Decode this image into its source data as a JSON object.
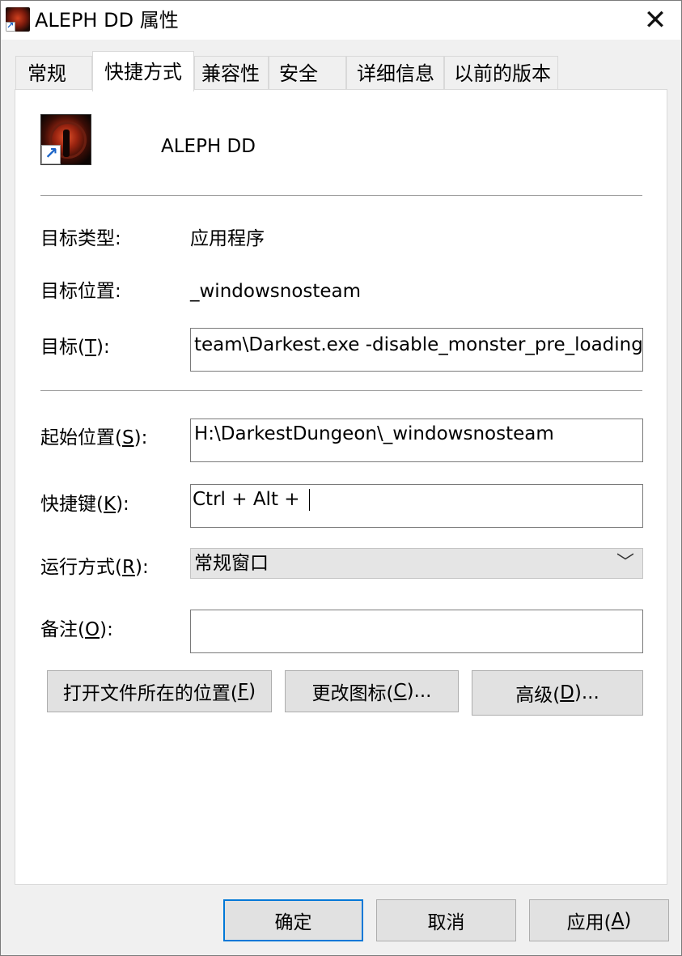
{
  "window": {
    "title": "ALEPH DD 属性"
  },
  "tabs": [
    {
      "label": "常规"
    },
    {
      "label": "快捷方式"
    },
    {
      "label": "兼容性"
    },
    {
      "label": "安全"
    },
    {
      "label": "详细信息"
    },
    {
      "label": "以前的版本"
    }
  ],
  "active_tab": "快捷方式",
  "shortcut": {
    "name": "ALEPH DD"
  },
  "info": {
    "target_type_label": "目标类型:",
    "target_type_value": "应用程序",
    "target_location_label": "目标位置:",
    "target_location_value": "_windowsnosteam",
    "target_label_pre": "目标(",
    "target_label_key": "T",
    "target_label_post": "):",
    "target_value": "team\\Darkest.exe -disable_monster_pre_loading"
  },
  "fields": {
    "start_in_label_pre": "起始位置(",
    "start_in_label_key": "S",
    "start_in_label_post": "):",
    "start_in_value": "H:\\DarkestDungeon\\_windowsnosteam",
    "hotkey_label_pre": "快捷键(",
    "hotkey_label_key": "K",
    "hotkey_label_post": "):",
    "hotkey_value": "Ctrl + Alt + ",
    "run_label_pre": "运行方式(",
    "run_label_key": "R",
    "run_label_post": "):",
    "run_value": "常规窗口",
    "comment_label_pre": "备注(",
    "comment_label_key": "O",
    "comment_label_post": "):",
    "comment_value": ""
  },
  "action_buttons": {
    "open_location_pre": "打开文件所在的位置(",
    "open_location_key": "F",
    "open_location_post": ")",
    "change_icon_pre": "更改图标(",
    "change_icon_key": "C",
    "change_icon_post": ")...",
    "advanced_pre": "高级(",
    "advanced_key": "D",
    "advanced_post": ")..."
  },
  "footer": {
    "ok": "确定",
    "cancel": "取消",
    "apply_pre": "应用(",
    "apply_key": "A",
    "apply_post": ")"
  },
  "icons": {
    "app": "darkest-dungeon-app-icon",
    "shortcut_overlay": "shortcut-arrow-icon",
    "close": "close-icon",
    "dropdown": "chevron-down-icon"
  }
}
